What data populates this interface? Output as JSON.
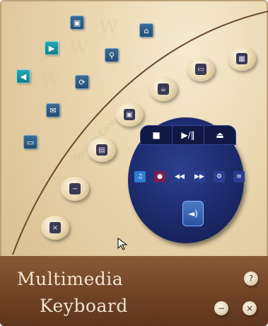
{
  "app": {
    "title_line1": "Multimedia",
    "title_line2": "Keyboard",
    "arc_text": "System Controller"
  },
  "colors": {
    "background": "#e8d3aa",
    "bottom_bar": "#6e4124",
    "panel": "#1c2a6b",
    "square_button": "#244f74",
    "square_button_cyan": "#167c86"
  },
  "left_buttons": [
    {
      "name": "home-icon"
    },
    {
      "name": "my-computer-icon"
    },
    {
      "name": "forward-icon"
    },
    {
      "name": "search-icon"
    },
    {
      "name": "back-icon"
    },
    {
      "name": "refresh-icon"
    },
    {
      "name": "mail-icon"
    },
    {
      "name": "folder-icon"
    }
  ],
  "pill_buttons": [
    {
      "name": "calculator-icon"
    },
    {
      "name": "monitor-icon"
    },
    {
      "name": "coffee-icon"
    },
    {
      "name": "camera-icon"
    },
    {
      "name": "calendar-icon"
    },
    {
      "name": "minimize-icon"
    },
    {
      "name": "close-icon"
    }
  ],
  "panel": {
    "stop": {
      "glyph": "■"
    },
    "play_pause": {
      "glyph": "▶/‖"
    },
    "eject": {
      "glyph": "⏏"
    },
    "mini_buttons": [
      {
        "name": "media-player-icon",
        "glyph": "♫",
        "color": "#2f7bd1"
      },
      {
        "name": "record-icon",
        "glyph": "●",
        "color": "#7a2050"
      },
      {
        "name": "previous-track-icon",
        "glyph": "◀◀",
        "color": "#2a3f92"
      },
      {
        "name": "next-track-icon",
        "glyph": "▶▶",
        "color": "#2a3f92"
      },
      {
        "name": "settings-icon",
        "glyph": "⚙",
        "color": "#2a3f92"
      },
      {
        "name": "playlist-icon",
        "glyph": "≡",
        "color": "#2a3f92"
      }
    ],
    "volume": {
      "glyph": "◄)"
    }
  },
  "corner_buttons": [
    {
      "name": "help-button",
      "glyph": "?"
    },
    {
      "name": "minimize-button",
      "glyph": "−"
    },
    {
      "name": "close-button",
      "glyph": "×"
    }
  ]
}
